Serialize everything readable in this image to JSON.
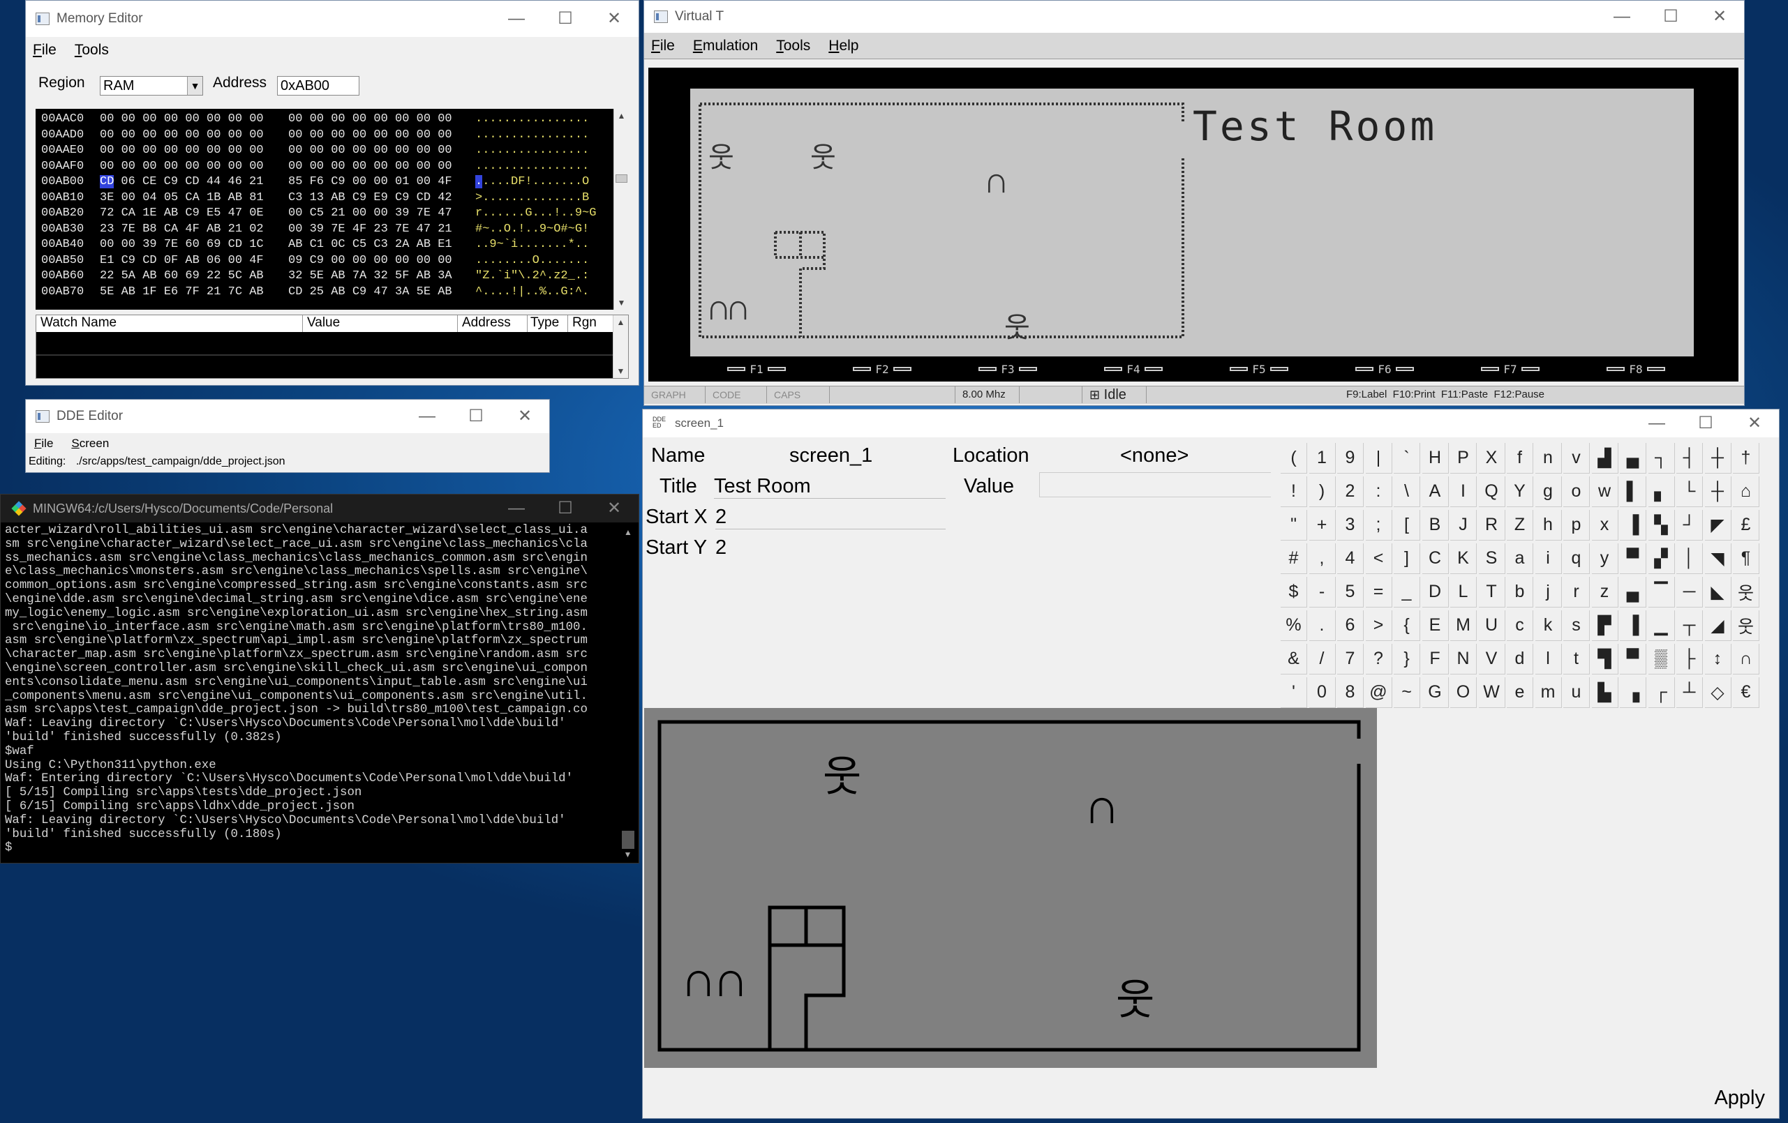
{
  "memory_editor": {
    "title": "Memory Editor",
    "menu": [
      "File",
      "Tools"
    ],
    "region_label": "Region",
    "region_value": "RAM",
    "address_label": "Address",
    "address_value": "0xAB00",
    "rows": [
      {
        "addr": "00AAC0",
        "hex1": "00 00 00 00 00 00 00 00",
        "hex2": "00 00 00 00 00 00 00 00",
        "ascii": "................"
      },
      {
        "addr": "00AAD0",
        "hex1": "00 00 00 00 00 00 00 00",
        "hex2": "00 00 00 00 00 00 00 00",
        "ascii": "................"
      },
      {
        "addr": "00AAE0",
        "hex1": "00 00 00 00 00 00 00 00",
        "hex2": "00 00 00 00 00 00 00 00",
        "ascii": "................"
      },
      {
        "addr": "00AAF0",
        "hex1": "00 00 00 00 00 00 00 00",
        "hex2": "00 00 00 00 00 00 00 00",
        "ascii": "................"
      },
      {
        "addr": "00AB00",
        "hex_sel": "CD",
        "hex1": "06 CE C9 CD 44 46 21",
        "hex2": "85 F6 C9 00 00 01 00 4F",
        "ascii_sel": ".",
        "ascii": "....DF!.......O"
      },
      {
        "addr": "00AB10",
        "hex1": "3E 00 04 05 CA 1B AB 81",
        "hex2": "C3 13 AB C9 E9 C9 CD 42",
        "ascii": ">..............B"
      },
      {
        "addr": "00AB20",
        "hex1": "72 CA 1E AB C9 E5 47 0E",
        "hex2": "00 C5 21 00 00 39 7E 47",
        "ascii": "r......G...!..9~G"
      },
      {
        "addr": "00AB30",
        "hex1": "23 7E B8 CA 4F AB 21 02",
        "hex2": "00 39 7E 4F 23 7E 47 21",
        "ascii": "#~..O.!..9~O#~G!"
      },
      {
        "addr": "00AB40",
        "hex1": "00 00 39 7E 60 69 CD 1C",
        "hex2": "AB C1 0C C5 C3 2A AB E1",
        "ascii": "..9~`i.......*.."
      },
      {
        "addr": "00AB50",
        "hex1": "E1 C9 CD 0F AB 06 00 4F",
        "hex2": "09 C9 00 00 00 00 00 00",
        "ascii": "........O......."
      },
      {
        "addr": "00AB60",
        "hex1": "22 5A AB 60 69 22 5C AB",
        "hex2": "32 5E AB 7A 32 5F AB 3A",
        "ascii": "\"Z.`i\"\\.2^.z2_.:"
      },
      {
        "addr": "00AB70",
        "hex1": "5E AB 1F E6 7F 21 7C AB",
        "hex2": "CD 25 AB C9 47 3A 5E AB",
        "ascii": "^....!|..%..G:^."
      }
    ],
    "watch_columns": [
      "Watch Name",
      "Value",
      "Address",
      "Type",
      "Rgn"
    ]
  },
  "dde_editor": {
    "title": "DDE Editor",
    "menu": [
      "File",
      "Screen"
    ],
    "editing_label": "Editing:",
    "editing_path": "./src/apps/test_campaign/dde_project.json"
  },
  "terminal": {
    "title": "MINGW64:/c/Users/Hysco/Documents/Code/Personal",
    "lines": [
      "acter_wizard\\roll_abilities_ui.asm src\\engine\\character_wizard\\select_class_ui.a",
      "sm src\\engine\\character_wizard\\select_race_ui.asm src\\engine\\class_mechanics\\cla",
      "ss_mechanics.asm src\\engine\\class_mechanics\\class_mechanics_common.asm src\\engin",
      "e\\class_mechanics\\monsters.asm src\\engine\\class_mechanics\\spells.asm src\\engine\\",
      "common_options.asm src\\engine\\compressed_string.asm src\\engine\\constants.asm src",
      "\\engine\\dde.asm src\\engine\\decimal_string.asm src\\engine\\dice.asm src\\engine\\ene",
      "my_logic\\enemy_logic.asm src\\engine\\exploration_ui.asm src\\engine\\hex_string.asm",
      " src\\engine\\io_interface.asm src\\engine\\math.asm src\\engine\\platform\\trs80_m100.",
      "asm src\\engine\\platform\\zx_spectrum\\api_impl.asm src\\engine\\platform\\zx_spectrum",
      "\\character_map.asm src\\engine\\platform\\zx_spectrum.asm src\\engine\\random.asm src",
      "\\engine\\screen_controller.asm src\\engine\\skill_check_ui.asm src\\engine\\ui_compon",
      "ents\\consolidate_menu.asm src\\engine\\ui_components\\input_table.asm src\\engine\\ui",
      "_components\\menu.asm src\\engine\\ui_components\\ui_components.asm src\\engine\\util.",
      "asm src\\apps\\test_campaign\\dde_project.json -> build\\trs80_m100\\test_campaign.co",
      "Waf: Leaving directory `C:\\Users\\Hysco\\Documents\\Code\\Personal\\mol\\dde\\build'",
      "'build' finished successfully (0.382s)",
      "$waf",
      "Using C:\\Python311\\python.exe",
      "Waf: Entering directory `C:\\Users\\Hysco\\Documents\\Code\\Personal\\mol\\dde\\build'",
      "[ 5/15] Compiling src\\apps\\tests\\dde_project.json",
      "[ 6/15] Compiling src\\apps\\ldhx\\dde_project.json",
      "Waf: Leaving directory `C:\\Users\\Hysco\\Documents\\Code\\Personal\\mol\\dde\\build'",
      "'build' finished successfully (0.180s)",
      "$"
    ]
  },
  "virtual_t": {
    "title": "Virtual T",
    "menu": [
      "File",
      "Emulation",
      "Tools",
      "Help"
    ],
    "screen_title": "Test Room",
    "fkeys": [
      "F1",
      "F2",
      "F3",
      "F4",
      "F5",
      "F6",
      "F7",
      "F8"
    ],
    "status": {
      "graph": "GRAPH",
      "code": "CODE",
      "caps": "CAPS",
      "speed": "8.00 Mhz",
      "state": "Idle",
      "hints": "F9:Label  F10:Print  F11:Paste  F12:Pause"
    }
  },
  "screen_editor": {
    "title": "screen_1",
    "name_label": "Name",
    "name_value": "screen_1",
    "location_label": "Location",
    "location_value": "<none>",
    "title_label": "Title",
    "title_value": "Test Room",
    "value_label": "Value",
    "value_value": "",
    "startx_label": "Start X",
    "startx_value": "2",
    "starty_label": "Start Y",
    "starty_value": "2",
    "apply_label": "Apply",
    "charmap_columns": [
      [
        "(",
        "!",
        "\"",
        "#",
        "$",
        "%",
        "&",
        "'"
      ],
      [
        "1",
        ")",
        "+",
        ",",
        "-",
        ".",
        "/",
        "0"
      ],
      [
        "9",
        "2",
        "3",
        "4",
        "5",
        "6",
        "7",
        "8"
      ],
      [
        "|",
        ":",
        ";",
        "<",
        "=",
        ">",
        "?",
        "@"
      ],
      [
        "`",
        "\\",
        "[",
        "]",
        "_",
        "{",
        "}",
        "~"
      ],
      [
        "H",
        "A",
        "B",
        "C",
        "D",
        "E",
        "F",
        "G"
      ],
      [
        "P",
        "I",
        "J",
        "K",
        "L",
        "M",
        "N",
        "O"
      ],
      [
        "X",
        "Q",
        "R",
        "S",
        "T",
        "U",
        "V",
        "W"
      ],
      [
        "f",
        "Y",
        "Z",
        "a",
        "b",
        "c",
        "d",
        "e"
      ],
      [
        "n",
        "g",
        "h",
        "i",
        "j",
        "k",
        "l",
        "m"
      ],
      [
        "v",
        "o",
        "p",
        "q",
        "r",
        "s",
        "t",
        "u"
      ],
      [
        "▟",
        "w",
        "x",
        "y",
        "z",
        "▛",
        "▜",
        "▙"
      ],
      [
        "▄",
        "▌",
        "▐",
        "▀",
        "▄",
        "▐",
        "▀",
        "▗"
      ],
      [
        "┐",
        "▖",
        "▚",
        "▞",
        "▔",
        "▁",
        "▒",
        "┌"
      ],
      [
        "┤",
        "└",
        "┘",
        "│",
        "─",
        "┬",
        "├",
        "┴"
      ],
      [
        "┼",
        "┼",
        "◤",
        "◥",
        "◣",
        "◢",
        "↕",
        "◇"
      ],
      [
        "†",
        "⌂",
        "£",
        "¶",
        "웃",
        "웃",
        "∩",
        "€"
      ]
    ],
    "glyph_person": "웃",
    "glyph_arch": "∩"
  }
}
